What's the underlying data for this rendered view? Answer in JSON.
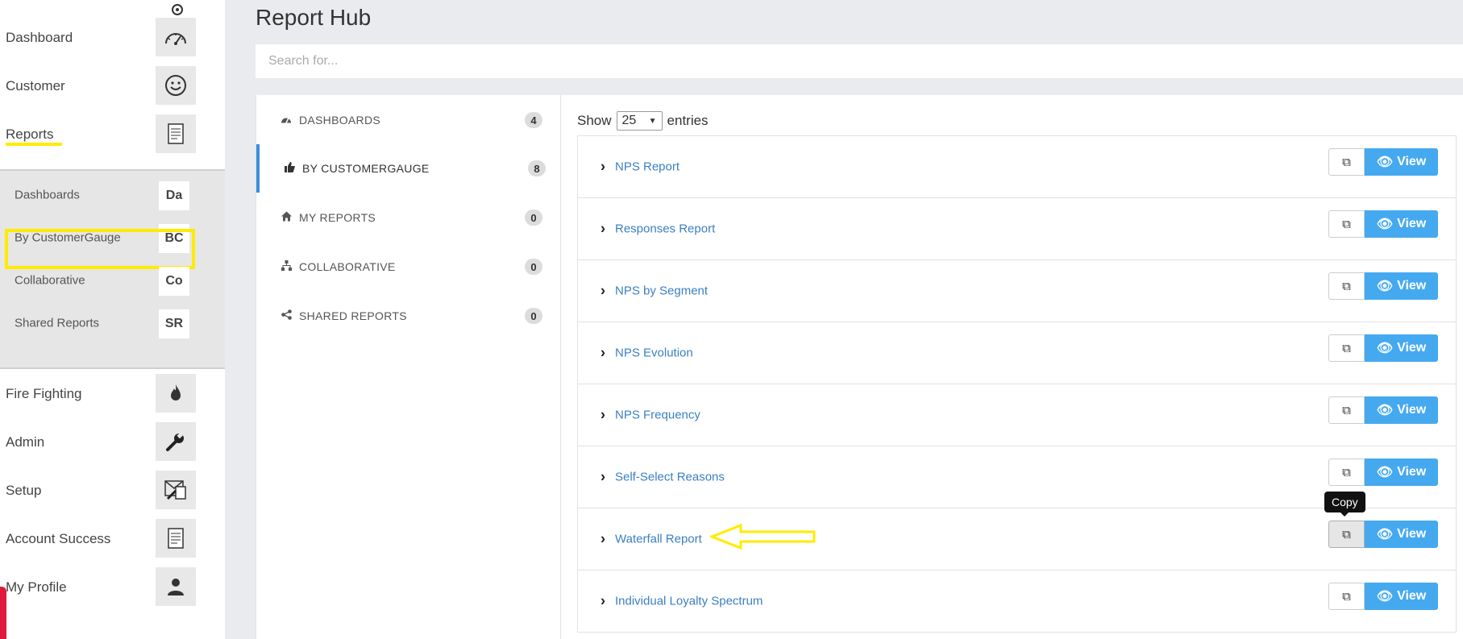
{
  "sidebar": {
    "nav_top": [
      {
        "label": "Dashboard",
        "icon": "speedometer-icon"
      },
      {
        "label": "Customer",
        "icon": "smiley-icon"
      },
      {
        "label": "Reports",
        "icon": "document-icon"
      }
    ],
    "subnav": [
      {
        "label": "Dashboards",
        "abbr": "Da"
      },
      {
        "label": "By CustomerGauge",
        "abbr": "BC"
      },
      {
        "label": "Collaborative",
        "abbr": "Co"
      },
      {
        "label": "Shared Reports",
        "abbr": "SR"
      }
    ],
    "nav_bottom": [
      {
        "label": "Fire Fighting",
        "icon": "flame-icon"
      },
      {
        "label": "Admin",
        "icon": "wrench-icon"
      },
      {
        "label": "Setup",
        "icon": "setup-icon"
      },
      {
        "label": "Account Success",
        "icon": "document-icon"
      },
      {
        "label": "My Profile",
        "icon": "user-icon"
      }
    ]
  },
  "main": {
    "title": "Report Hub",
    "search_placeholder": "Search for...",
    "categories": [
      {
        "label": "DASHBOARDS",
        "count": "4",
        "icon": "speedometer-icon"
      },
      {
        "label": "BY CUSTOMERGAUGE",
        "count": "8",
        "icon": "thumbs-up-icon"
      },
      {
        "label": "MY REPORTS",
        "count": "0",
        "icon": "home-icon"
      },
      {
        "label": "COLLABORATIVE",
        "count": "0",
        "icon": "sitemap-icon"
      },
      {
        "label": "SHARED REPORTS",
        "count": "0",
        "icon": "share-icon"
      }
    ],
    "show_label": "Show",
    "entries_value": "25",
    "entries_label": "entries",
    "reports": [
      {
        "name": "NPS Report"
      },
      {
        "name": "Responses Report"
      },
      {
        "name": "NPS by Segment"
      },
      {
        "name": "NPS Evolution"
      },
      {
        "name": "NPS Frequency"
      },
      {
        "name": "Self-Select Reasons"
      },
      {
        "name": "Waterfall Report"
      },
      {
        "name": "Individual Loyalty Spectrum"
      }
    ],
    "view_label": "View",
    "tooltip": "Copy"
  },
  "colors": {
    "accent": "#45a9f0",
    "link": "#3b7fc2",
    "highlight": "#ffeb00",
    "active_border": "#3b8fd9"
  }
}
